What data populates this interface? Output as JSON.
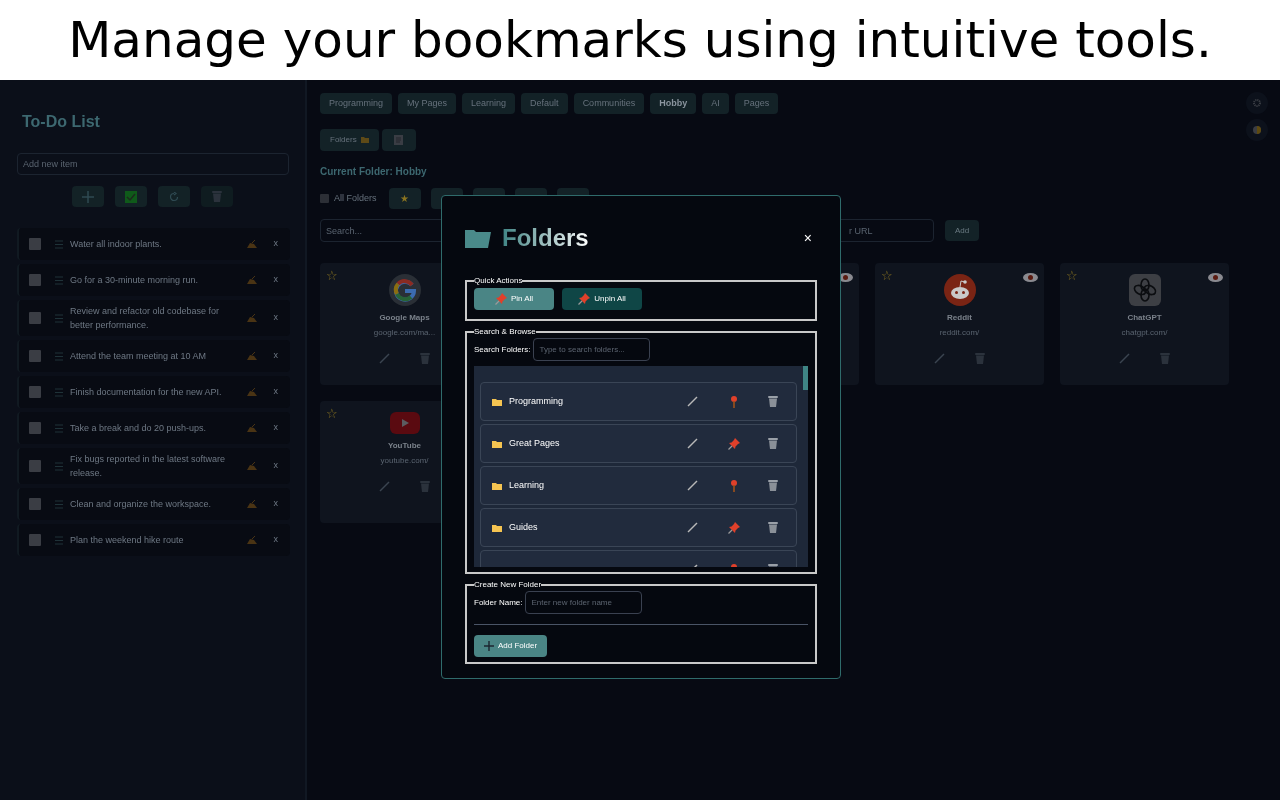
{
  "caption": "Manage your bookmarks using intuitive tools.",
  "todo": {
    "title": "To-Do List",
    "placeholder": "Add new item",
    "items": [
      {
        "text": "Water all indoor plants.",
        "checked": false,
        "delete": "x"
      },
      {
        "text": "Go for a 30-minute morning run.",
        "checked": false,
        "delete": "x"
      },
      {
        "text": "Review and refactor old codebase for better performance.",
        "checked": false,
        "delete": "x"
      },
      {
        "text": "Attend the team meeting at 10 AM",
        "checked": false,
        "delete": "x"
      },
      {
        "text": "Finish documentation for the new API.",
        "checked": false,
        "delete": "x"
      },
      {
        "text": "Take a break and do 20 push-ups.",
        "checked": false,
        "delete": "x"
      },
      {
        "text": "Fix bugs reported in the latest software release.",
        "checked": false,
        "delete": "x"
      },
      {
        "text": "Clean and organize the workspace.",
        "checked": false,
        "delete": "x"
      },
      {
        "text": "Plan the weekend hike route",
        "checked": false,
        "delete": "x"
      }
    ]
  },
  "tabs": [
    {
      "label": "Programming",
      "selected": false
    },
    {
      "label": "My Pages",
      "selected": false
    },
    {
      "label": "Learning",
      "selected": false
    },
    {
      "label": "Default",
      "selected": false
    },
    {
      "label": "Communities",
      "selected": false
    },
    {
      "label": "Hobby",
      "selected": true
    },
    {
      "label": "AI",
      "selected": false
    },
    {
      "label": "Pages",
      "selected": false
    }
  ],
  "folders_button": "Folders",
  "current_folder": "Current Folder: Hobby",
  "all_folders": {
    "label": "All Folders",
    "checked": false
  },
  "favorites_star": "★",
  "search_placeholder": "Search...",
  "url_placeholder": "r URL",
  "add_button": "Add",
  "cards": [
    {
      "kind": "google",
      "star": "☆",
      "name": "Google Maps",
      "url": "google.com/ma..."
    },
    {
      "kind": "hidden"
    },
    {
      "kind": "covered"
    },
    {
      "kind": "reddit",
      "star": "☆",
      "name": "Reddit",
      "url": "reddit.com/"
    },
    {
      "kind": "chatgpt",
      "star": "☆",
      "name": "ChatGPT",
      "url": "chatgpt.com/"
    },
    {
      "kind": "youtube",
      "star": "☆",
      "name": "YouTube",
      "url": "youtube.com/"
    }
  ],
  "modal": {
    "title": "Folders",
    "close": "×",
    "quick_actions": {
      "legend": "Quick Actions",
      "pin_all": "Pin All",
      "unpin_all": "Unpin All"
    },
    "browse": {
      "legend": "Search & Browse",
      "label": "Search Folders:",
      "placeholder": "Type to search folders...",
      "folders": [
        {
          "name": "Programming",
          "pinned": true
        },
        {
          "name": "Great Pages",
          "pinned": false
        },
        {
          "name": "Learning",
          "pinned": true
        },
        {
          "name": "Guides",
          "pinned": false
        },
        {
          "pinned": true
        }
      ]
    },
    "create": {
      "legend": "Create New Folder",
      "label": "Folder Name:",
      "placeholder": "Enter new folder name",
      "button": "Add Folder"
    }
  }
}
